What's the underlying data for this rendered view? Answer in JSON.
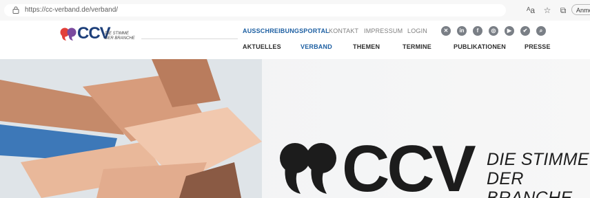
{
  "browser": {
    "url": "https://cc-verband.de/verband/",
    "signin_label": "Anmel",
    "icons": [
      "lock-icon",
      "reading-mode-icon",
      "favorites-star-icon",
      "collections-icon"
    ]
  },
  "header": {
    "logo_text": "CCV",
    "logo_tagline_1": "DIE STIMME",
    "logo_tagline_2": "DER BRANCHE",
    "top_nav": [
      {
        "label": "AUSSCHREIBUNGSPORTAL",
        "active": true
      },
      {
        "label": "KONTAKT",
        "active": false
      },
      {
        "label": "IMPRESSUM",
        "active": false
      },
      {
        "label": "LOGIN",
        "active": false
      }
    ],
    "social_icons": [
      "xing-icon",
      "linkedin-icon",
      "facebook-icon",
      "instagram-icon",
      "youtube-icon",
      "twitter-icon",
      "search-icon"
    ],
    "main_nav": [
      {
        "label": "AKTUELLES",
        "active": false
      },
      {
        "label": "VERBAND",
        "active": true
      },
      {
        "label": "THEMEN",
        "active": false
      },
      {
        "label": "TERMINE",
        "active": false
      },
      {
        "label": "PUBLIKATIONEN",
        "active": false
      },
      {
        "label": "PRESSE",
        "active": false
      }
    ]
  },
  "hero": {
    "logo_text": "CCV",
    "tagline_1": "DIE STIMME",
    "tagline_2": "DER BRANCHE"
  },
  "colors": {
    "accent_blue": "#1d5fa2",
    "quote_red": "#e2403a",
    "quote_purple": "#7b4a9e",
    "logo_navy": "#1d3f7a"
  }
}
